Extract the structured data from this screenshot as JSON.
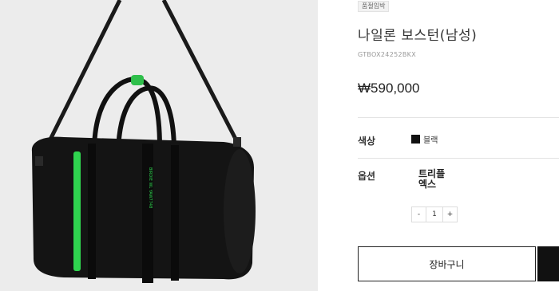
{
  "product": {
    "badge": "품절임박",
    "title": "나일론 보스턴(남성)",
    "sku": "GTBOX24252BKX",
    "price": "₩590,000"
  },
  "options": {
    "color_label": "색상",
    "color_value": "블랙",
    "color_swatch": "#111111",
    "option_label": "옵션",
    "option_value": "트리플 엑스"
  },
  "quantity": {
    "minus": "-",
    "value": "1",
    "plus": "+"
  },
  "actions": {
    "cart_label": "장바구니"
  },
  "image": {
    "bag_text": "BIRDIE WL YAW7748"
  }
}
